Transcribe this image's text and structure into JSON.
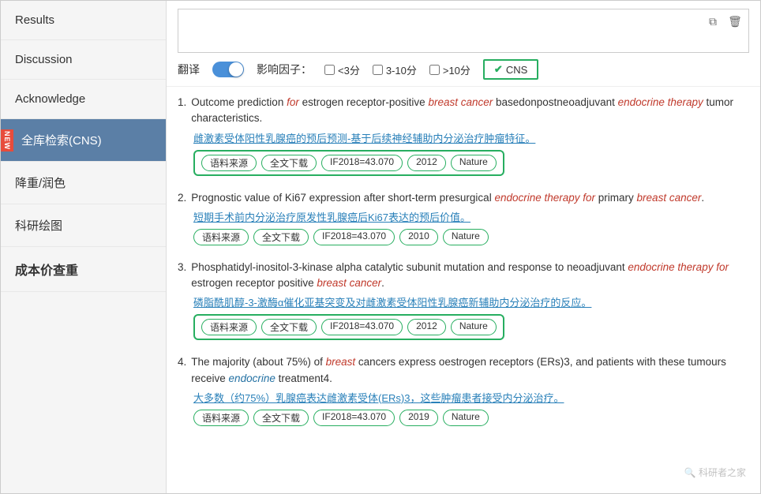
{
  "sidebar": {
    "items": [
      {
        "id": "results",
        "label": "Results",
        "active": false,
        "badge": false,
        "bold": false
      },
      {
        "id": "discussion",
        "label": "Discussion",
        "active": false,
        "badge": false,
        "bold": false
      },
      {
        "id": "acknowledge",
        "label": "Acknowledge",
        "active": false,
        "badge": false,
        "bold": false
      },
      {
        "id": "full-search",
        "label": "全库检索(CNS)",
        "active": true,
        "badge": true,
        "badge_text": "NEW",
        "bold": false
      },
      {
        "id": "image-color",
        "label": "降重/润色",
        "active": false,
        "badge": false,
        "bold": false
      },
      {
        "id": "research-chart",
        "label": "科研绘图",
        "active": false,
        "badge": false,
        "bold": false
      },
      {
        "id": "cost-check",
        "label": "成本价查重",
        "active": false,
        "badge": false,
        "bold": true
      }
    ]
  },
  "filter": {
    "translate_label": "翻译",
    "impact_label": "影响因子：",
    "opt1": "<3分",
    "opt2": "3-10分",
    "opt3": ">10分",
    "cns_label": "CNS",
    "cns_checked": true
  },
  "results": [
    {
      "num": "1.",
      "title_parts": [
        {
          "text": "Outcome prediction ",
          "type": "normal"
        },
        {
          "text": "for",
          "type": "italic-red"
        },
        {
          "text": " estrogen receptor-positive ",
          "type": "normal"
        },
        {
          "text": "breast cancer",
          "type": "italic-red"
        },
        {
          "text": " basedonpostneoadjuvant ",
          "type": "normal"
        },
        {
          "text": "endo",
          "type": "italic-red"
        },
        {
          "text": "crine therapy",
          "type": "italic-red"
        },
        {
          "text": " tumor characteristics.",
          "type": "normal"
        }
      ],
      "translated": "雌激素受体阳性乳腺癌的预后预测-基于后续神经辅助内分泌治疗肿瘤特征。",
      "tags": [
        "语料来源",
        "全文下载",
        "IF2018=43.070",
        "2012",
        "Nature"
      ],
      "tags_bordered": true
    },
    {
      "num": "2.",
      "title_parts": [
        {
          "text": "Prognostic value of Ki67 expression after short-term presurgical ",
          "type": "normal"
        },
        {
          "text": "endocrine therapy for",
          "type": "italic-red"
        },
        {
          "text": " primary ",
          "type": "normal"
        },
        {
          "text": "breast cancer",
          "type": "italic-red"
        },
        {
          "text": ".",
          "type": "normal"
        }
      ],
      "translated": "短期手术前内分泌治疗原发性乳腺癌后Ki67表达的预后价值。",
      "tags": [
        "语料来源",
        "全文下载",
        "IF2018=43.070",
        "2010",
        "Nature"
      ],
      "tags_bordered": false
    },
    {
      "num": "3.",
      "title_parts": [
        {
          "text": "Phosphatidyl-inositol-3-kinase alpha catalytic subunit mutation and response to neoadjuvant ",
          "type": "normal"
        },
        {
          "text": "en",
          "type": "italic-red"
        },
        {
          "text": "docrine therapy ",
          "type": "italic-red"
        },
        {
          "text": "for",
          "type": "italic-red"
        },
        {
          "text": " estrogen receptor positive ",
          "type": "normal"
        },
        {
          "text": "breast cancer",
          "type": "italic-red"
        },
        {
          "text": ".",
          "type": "normal"
        }
      ],
      "translated": "磷脂酰肌醇-3-激酶α催化亚基突变及对雌激素受体阳性乳腺癌新辅助内分泌治疗的反应。",
      "tags": [
        "语料来源",
        "全文下载",
        "IF2018=43.070",
        "2012",
        "Nature"
      ],
      "tags_bordered": true
    },
    {
      "num": "4.",
      "title_parts": [
        {
          "text": "The majority (about 75%) of ",
          "type": "normal"
        },
        {
          "text": "breast",
          "type": "italic-red"
        },
        {
          "text": " cancers express oestrogen receptors (ERs)3, and patients wi",
          "type": "normal"
        },
        {
          "text": "th these tumours receive ",
          "type": "normal"
        },
        {
          "text": "endocrine",
          "type": "italic-blue"
        },
        {
          "text": " treatment4.",
          "type": "normal"
        }
      ],
      "translated": "大多数（约75%）乳腺癌表达雌激素受体(ERs)3，这些肿瘤患者接受内分泌治疗。",
      "tags": [
        "语料来源",
        "全文下载",
        "IF2018=43.070",
        "2019",
        "Nature"
      ],
      "tags_bordered": false
    }
  ],
  "watermark": "🔍 科研者之家"
}
